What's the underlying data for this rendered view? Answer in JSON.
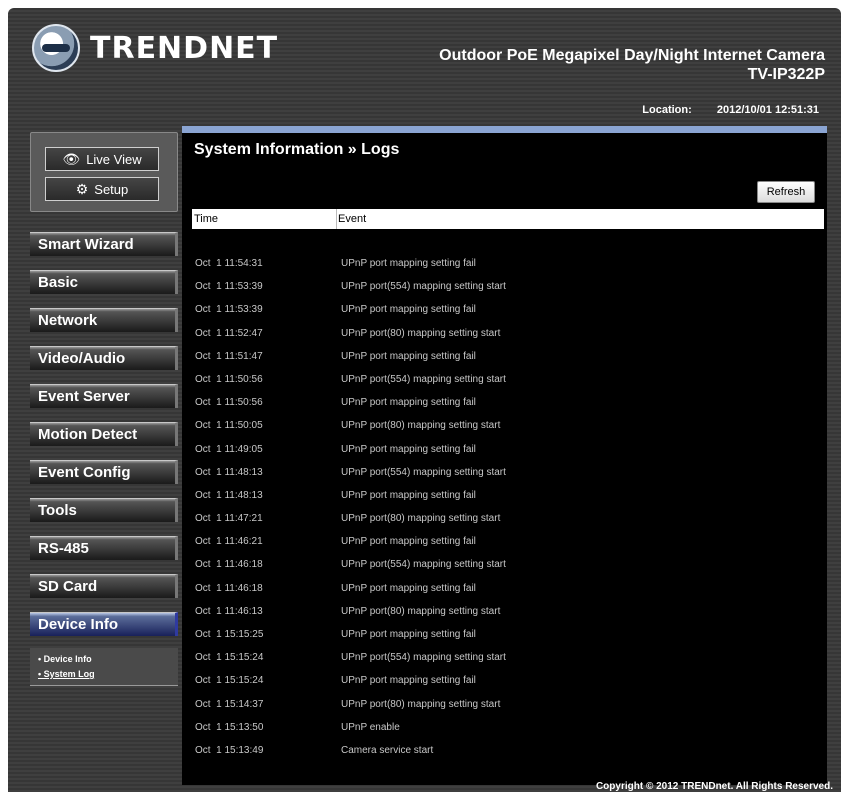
{
  "brand": {
    "name": "TRENDNET"
  },
  "product": {
    "title": "Outdoor PoE Megapixel Day/Night Internet Camera",
    "model": "TV-IP322P"
  },
  "status": {
    "location_label": "Location:",
    "datetime": "2012/10/01 12:51:31"
  },
  "top_buttons": {
    "live_view": "Live View",
    "setup": "Setup"
  },
  "menu": [
    {
      "label": "Smart Wizard"
    },
    {
      "label": "Basic"
    },
    {
      "label": "Network"
    },
    {
      "label": "Video/Audio"
    },
    {
      "label": "Event Server"
    },
    {
      "label": "Motion Detect"
    },
    {
      "label": "Event Config"
    },
    {
      "label": "Tools"
    },
    {
      "label": "RS-485"
    },
    {
      "label": "SD Card"
    },
    {
      "label": "Device Info"
    }
  ],
  "submenu": [
    {
      "label": "• Device Info"
    },
    {
      "label": "• System Log"
    }
  ],
  "page": {
    "title": "System Information » Logs",
    "refresh": "Refresh"
  },
  "table": {
    "headers": {
      "time": "Time",
      "event": "Event"
    },
    "rows": [
      {
        "time": "Oct  1 11:54:31",
        "event": "UPnP port mapping setting fail"
      },
      {
        "time": "Oct  1 11:53:39",
        "event": "UPnP port(554) mapping setting start"
      },
      {
        "time": "Oct  1 11:53:39",
        "event": "UPnP port mapping setting fail"
      },
      {
        "time": "Oct  1 11:52:47",
        "event": "UPnP port(80) mapping setting start"
      },
      {
        "time": "Oct  1 11:51:47",
        "event": "UPnP port mapping setting fail"
      },
      {
        "time": "Oct  1 11:50:56",
        "event": "UPnP port(554) mapping setting start"
      },
      {
        "time": "Oct  1 11:50:56",
        "event": "UPnP port mapping setting fail"
      },
      {
        "time": "Oct  1 11:50:05",
        "event": "UPnP port(80) mapping setting start"
      },
      {
        "time": "Oct  1 11:49:05",
        "event": "UPnP port mapping setting fail"
      },
      {
        "time": "Oct  1 11:48:13",
        "event": "UPnP port(554) mapping setting start"
      },
      {
        "time": "Oct  1 11:48:13",
        "event": "UPnP port mapping setting fail"
      },
      {
        "time": "Oct  1 11:47:21",
        "event": "UPnP port(80) mapping setting start"
      },
      {
        "time": "Oct  1 11:46:21",
        "event": "UPnP port mapping setting fail"
      },
      {
        "time": "Oct  1 11:46:18",
        "event": "UPnP port(554) mapping setting start"
      },
      {
        "time": "Oct  1 11:46:18",
        "event": "UPnP port mapping setting fail"
      },
      {
        "time": "Oct  1 11:46:13",
        "event": "UPnP port(80) mapping setting start"
      },
      {
        "time": "Oct  1 15:15:25",
        "event": "UPnP port mapping setting fail"
      },
      {
        "time": "Oct  1 15:15:24",
        "event": "UPnP port(554) mapping setting start"
      },
      {
        "time": "Oct  1 15:15:24",
        "event": "UPnP port mapping setting fail"
      },
      {
        "time": "Oct  1 15:14:37",
        "event": "UPnP port(80) mapping setting start"
      },
      {
        "time": "Oct  1 15:13:50",
        "event": "UPnP enable"
      },
      {
        "time": "Oct  1 15:13:49",
        "event": "Camera service start"
      }
    ]
  },
  "footer": {
    "copyright": "Copyright © 2012 TRENDnet. All Rights Reserved."
  }
}
